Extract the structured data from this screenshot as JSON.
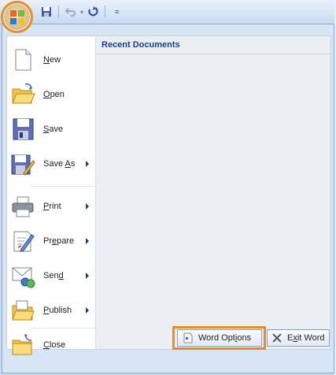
{
  "quick_access": {
    "items": [
      "save-icon",
      "undo-icon",
      "redo-icon",
      "customize-icon"
    ],
    "customize_symbol": "≡"
  },
  "menu": {
    "items": [
      {
        "name": "New",
        "key": "N",
        "rest": "ew",
        "has_submenu": false
      },
      {
        "name": "Open",
        "key": "O",
        "rest": "pen",
        "has_submenu": false
      },
      {
        "name": "Save",
        "key": "S",
        "rest": "ave",
        "has_submenu": false
      },
      {
        "name": "Save As",
        "pre": "Save ",
        "key": "A",
        "rest": "s",
        "has_submenu": true
      },
      {
        "name": "Print",
        "key": "P",
        "rest": "rint",
        "has_submenu": true
      },
      {
        "name": "Prepare",
        "pre": "Pr",
        "key": "e",
        "rest": "pare",
        "has_submenu": true
      },
      {
        "name": "Send",
        "pre": "Sen",
        "key": "d",
        "rest": "",
        "has_submenu": true
      },
      {
        "name": "Publish",
        "key": "P",
        "rest": "ublish",
        "has_submenu": true
      },
      {
        "name": "Close",
        "key": "C",
        "rest": "lose",
        "has_submenu": false
      }
    ],
    "recent_documents_title": "Recent Documents"
  },
  "footer": {
    "word_options_pre": "Word Opt",
    "word_options_key": "i",
    "word_options_post": "ons",
    "exit_pre": "E",
    "exit_key": "x",
    "exit_post": "it Word"
  },
  "colors": {
    "highlight": "#ef8a1f",
    "header_text": "#15428b"
  }
}
